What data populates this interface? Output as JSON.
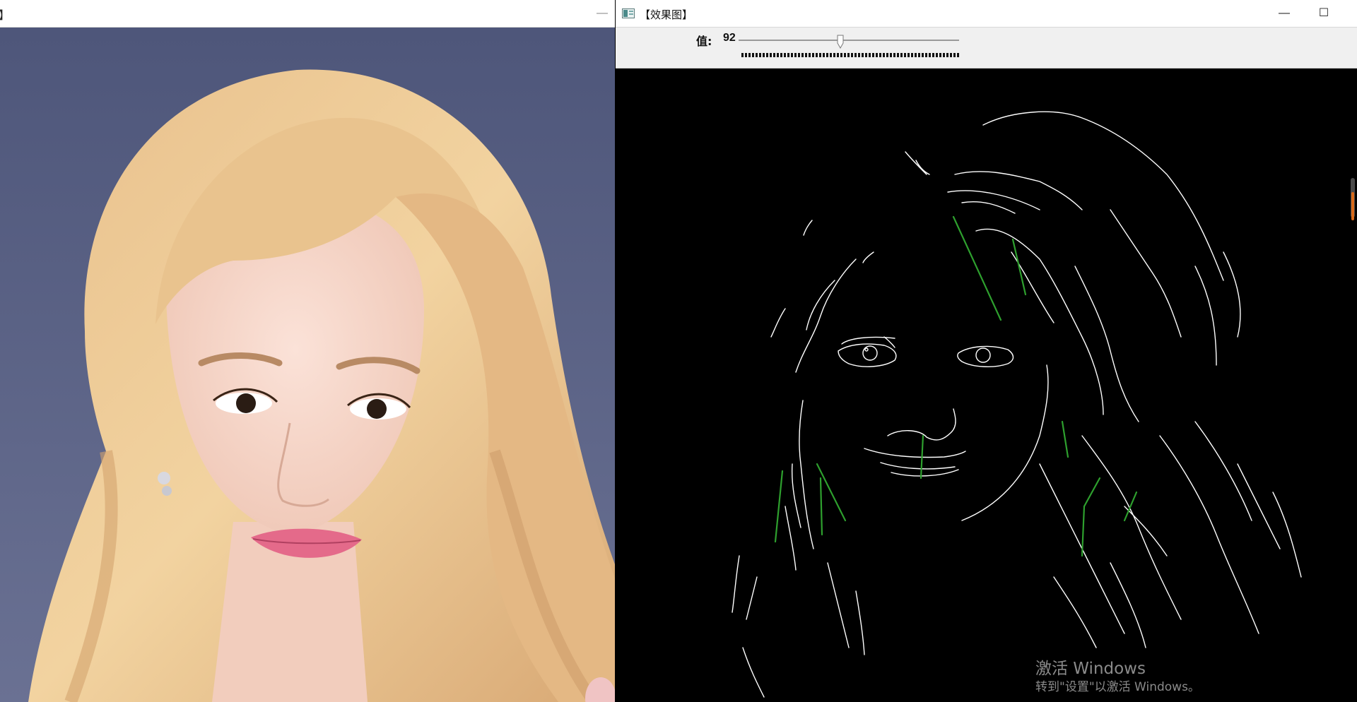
{
  "left_window": {
    "title_fragment": "】",
    "minimize_glyph": "—",
    "photo_alt": ""
  },
  "right_window": {
    "title": "【效果图】",
    "minimize_glyph": "—",
    "maximize_glyph": "☐",
    "trackbar": {
      "label": "值:",
      "value": "92",
      "position_fraction": 0.46
    },
    "watermark": {
      "line1": "激活 Windows",
      "line2": "转到\"设置\"以激活 Windows。"
    }
  },
  "colors": {
    "photo_background": "#5b6385",
    "edge_lines": "#ffffff",
    "detected_lines": "#2ea02e",
    "canvas": "#000000"
  }
}
